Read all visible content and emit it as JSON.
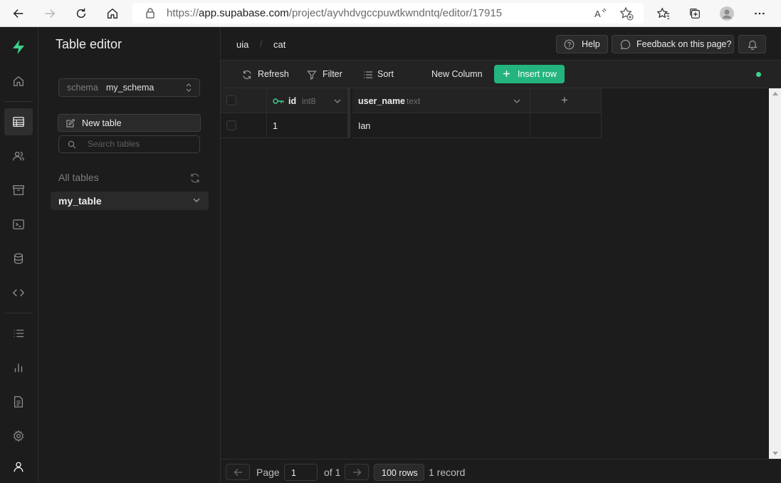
{
  "browser": {
    "url_prefix": "https://",
    "url_host": "app.supabase.com",
    "url_path": "/project/ayvhdvgccpuwtkwndntq/editor/17915"
  },
  "sidebar": {
    "title": "Table editor",
    "schema_label": "schema",
    "schema_value": "my_schema",
    "new_table_label": "New table",
    "search_placeholder": "Search tables",
    "all_tables_label": "All tables",
    "tables": [
      {
        "name": "my_table"
      }
    ]
  },
  "header": {
    "breadcrumbs": [
      "uia",
      "cat"
    ],
    "breadcrumb_separator": "/",
    "help_label": "Help",
    "feedback_label": "Feedback on this page?"
  },
  "toolbar": {
    "refresh_label": "Refresh",
    "filter_label": "Filter",
    "sort_label": "Sort",
    "new_column_label": "New Column",
    "insert_row_label": "Insert row"
  },
  "grid": {
    "columns": [
      {
        "name": "id",
        "type": "int8",
        "primary_key": true
      },
      {
        "name": "user_name",
        "type": "text",
        "primary_key": false
      }
    ],
    "add_column_symbol": "+",
    "rows": [
      {
        "id": "1",
        "user_name": "Ian"
      }
    ]
  },
  "footer": {
    "page_label": "Page",
    "page_value": "1",
    "of_label": "of 1",
    "rows_label": "100 rows",
    "record_count": "1 record"
  },
  "colors": {
    "brand_green": "#3ecf8e",
    "insert_button": "#24b47e",
    "background": "#1c1c1c"
  }
}
